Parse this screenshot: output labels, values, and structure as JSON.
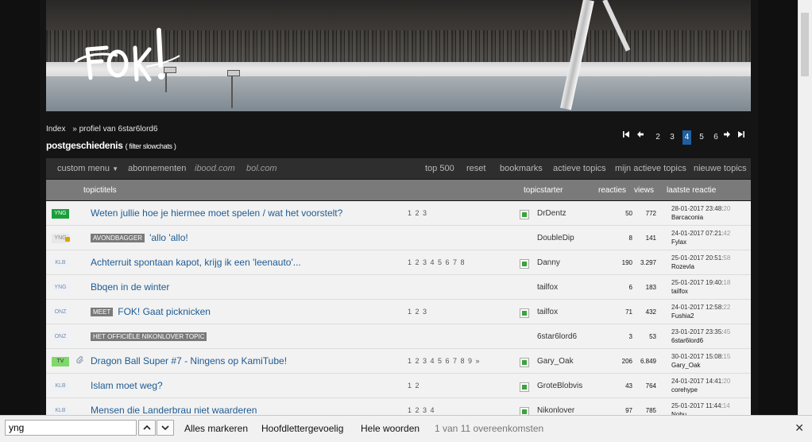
{
  "breadcrumb": {
    "home": "Index",
    "current": "» profiel van 6star6lord6"
  },
  "page_title": {
    "main": "postgeschiedenis",
    "sub": "( filter slowchats )"
  },
  "pagination": {
    "pages": [
      "2",
      "3",
      "4",
      "5",
      "6"
    ],
    "current": "4"
  },
  "menu": {
    "custom": "custom menu",
    "abonnementen": "abonnementen",
    "ibood": "ibood.com",
    "bol": "bol.com",
    "top500": "top 500",
    "reset": "reset",
    "bookmarks": "bookmarks",
    "actieve": "actieve topics",
    "mijn": "mijn actieve topics",
    "nieuwe": "nieuwe topics"
  },
  "table_header": {
    "topictitels": "topictitels",
    "topicstarter": "topicstarter",
    "reacties": "reacties",
    "views": "views",
    "laatste": "laatste reactie"
  },
  "rows": [
    {
      "badge": "YNG",
      "tag": "",
      "title": "Weten jullie hoe je hiermee moet spelen / wat het voorstelt?",
      "pages": "1 2 3",
      "starter": "DrDentz",
      "reacties": "50",
      "views": "772",
      "date": "28-01-2017 23:48:",
      "sec": "20",
      "user": "Barcaconia"
    },
    {
      "badge": "YNG",
      "tag": "AVONDBAGGER",
      "title": "'allo 'allo!",
      "pages": "",
      "starter": "DoubleDip",
      "reacties": "8",
      "views": "141",
      "date": "24-01-2017 07:21:",
      "sec": "42",
      "user": "Fylax"
    },
    {
      "badge": "KLB",
      "tag": "",
      "title": "Achterruit spontaan kapot, krijg ik een 'leenauto'...",
      "pages": "1 2 3 4 5 6 7 8",
      "starter": "Danny",
      "reacties": "190",
      "views": "3.297",
      "date": "25-01-2017 20:51:",
      "sec": "58",
      "user": "Rozevla"
    },
    {
      "badge": "YNG",
      "tag": "",
      "title": "Bbqen in de winter",
      "pages": "",
      "starter": "tailfox",
      "reacties": "6",
      "views": "183",
      "date": "25-01-2017 19:40:",
      "sec": "18",
      "user": "tailfox"
    },
    {
      "badge": "ONZ",
      "tag": "MEET",
      "title": "FOK! Gaat picknicken",
      "pages": "1 2 3",
      "starter": "tailfox",
      "reacties": "71",
      "views": "432",
      "date": "24-01-2017 12:58:",
      "sec": "22",
      "user": "Fushia2"
    },
    {
      "badge": "ONZ",
      "tag": "HET OFFICIËLE NIKONLOVER TOPIC",
      "title": "",
      "pages": "",
      "starter": "6star6lord6",
      "reacties": "3",
      "views": "53",
      "date": "23-01-2017 23:35:",
      "sec": "45",
      "user": "6star6lord6"
    },
    {
      "badge": "TV",
      "tag": "",
      "title": "Dragon Ball Super #7 - Ningens op KamiTube!",
      "pages": "1 2 3 4 5 6 7 8 9 »",
      "starter": "Gary_Oak",
      "reacties": "206",
      "views": "6.849",
      "date": "30-01-2017 15:08:",
      "sec": "15",
      "user": "Gary_Oak"
    },
    {
      "badge": "KLB",
      "tag": "",
      "title": "Islam moet weg?",
      "pages": "1 2",
      "starter": "GroteBlobvis",
      "reacties": "43",
      "views": "764",
      "date": "24-01-2017 14:41:",
      "sec": "20",
      "user": "corehype"
    },
    {
      "badge": "KLB",
      "tag": "",
      "title": "Mensen die Landerbrau niet waarderen",
      "pages": "1 2 3 4",
      "starter": "Nikonlover",
      "reacties": "97",
      "views": "785",
      "date": "25-01-2017 11:44:",
      "sec": "14",
      "user": "Nobu"
    }
  ],
  "findbar": {
    "query": "yng",
    "highlight_all": "Alles markeren",
    "match_case": "Hoofdlettergevoelig",
    "whole_words": "Hele woorden",
    "count": "1 van 11 overeenkomsten"
  }
}
